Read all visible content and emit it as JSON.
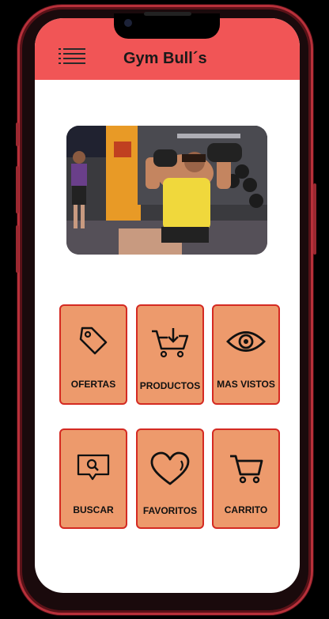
{
  "app": {
    "title": "Gym Bull´s"
  },
  "tiles": [
    {
      "label": "OFERTAS",
      "icon": "tag-icon"
    },
    {
      "label": "PRODUCTOS",
      "icon": "cart-download-icon"
    },
    {
      "label": "MAS VISTOS",
      "icon": "eye-icon"
    },
    {
      "label": "BUSCAR",
      "icon": "search-chat-icon"
    },
    {
      "label": "FAVORITOS",
      "icon": "heart-icon"
    },
    {
      "label": "CARRITO",
      "icon": "cart-icon"
    }
  ],
  "colors": {
    "header": "#f15556",
    "tile": "#ed9a6c",
    "tile_border": "#d42a22"
  }
}
